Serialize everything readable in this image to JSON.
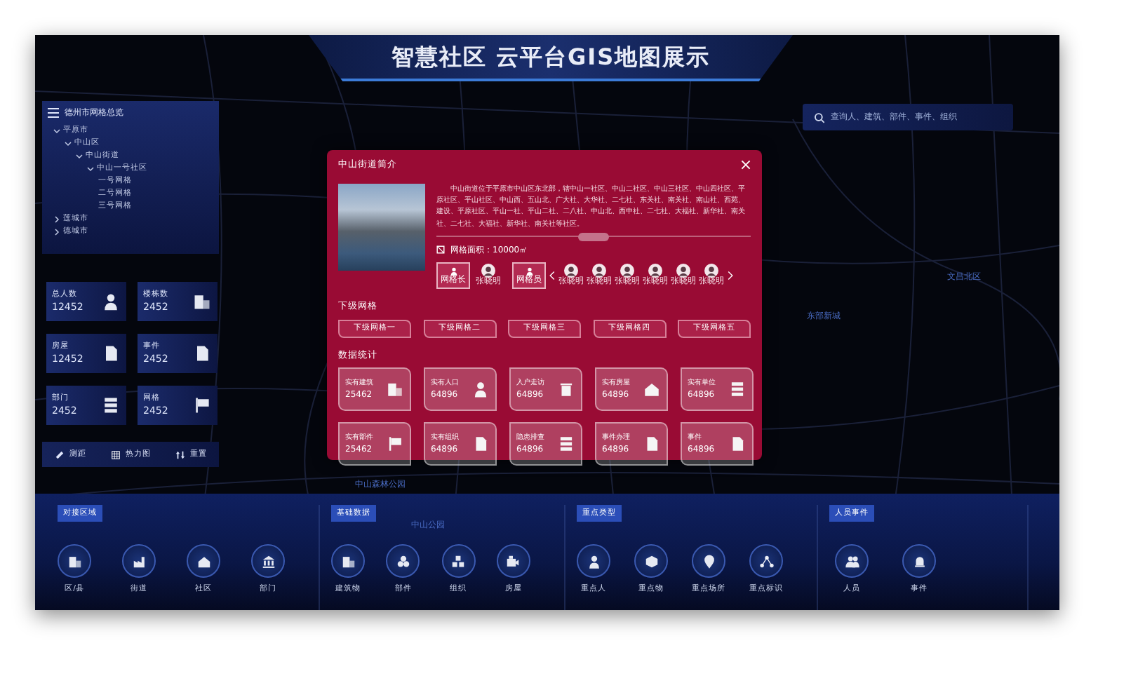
{
  "header": {
    "title": "智慧社区 云平台GIS地图展示"
  },
  "search": {
    "placeholder": "查询人、建筑、部件、事件、组织"
  },
  "grid_panel": {
    "title": "德州市网格总览",
    "tree": [
      {
        "label": "平原市",
        "expanded": true,
        "children": [
          {
            "label": "中山区",
            "expanded": true,
            "children": [
              {
                "label": "中山街道",
                "expanded": true,
                "children": [
                  {
                    "label": "中山一号社区",
                    "expanded": true,
                    "children": [
                      {
                        "label": "一号网格"
                      },
                      {
                        "label": "二号网格"
                      },
                      {
                        "label": "三号网格"
                      }
                    ]
                  }
                ]
              }
            ]
          }
        ]
      },
      {
        "label": "莲城市",
        "expanded": false
      },
      {
        "label": "德城市",
        "expanded": false
      }
    ]
  },
  "stats": [
    {
      "label": "总人数",
      "value": "12452"
    },
    {
      "label": "楼栋数",
      "value": "2452"
    },
    {
      "label": "房屋",
      "value": "12452"
    },
    {
      "label": "事件",
      "value": "2452"
    },
    {
      "label": "部门",
      "value": "2452"
    },
    {
      "label": "网格",
      "value": "2452"
    }
  ],
  "tools": [
    {
      "label": "测距"
    },
    {
      "label": "热力图"
    },
    {
      "label": "重置"
    }
  ],
  "map_labels": [
    {
      "text": "中山森林公园"
    },
    {
      "text": "东部新城"
    },
    {
      "text": "文昌北区"
    },
    {
      "text": "中山公园"
    }
  ],
  "modal": {
    "title": "中山街道简介",
    "intro": "中山街道位于平原市中山区东北部，辖中山一社区、中山二社区、中山三社区、中山四社区、平原社区、平山社区、中山西、五山北、广大社、大华社、二七社、东关社、南关社、南山社、西苑、建设、平原社区、平山一社、平山二社、二八社、中山北、西中社、二七社、大福社、新华社、南关社、二七社、大福社、新华社、南关社等社区。",
    "area": "网格面积：10000㎡",
    "leader": {
      "role": "网格长",
      "name": "张晓明"
    },
    "members": {
      "role": "网格员",
      "names": [
        "张晓明",
        "张晓明",
        "张晓明",
        "张晓明",
        "张晓明",
        "张晓明"
      ]
    },
    "sub_section": "下级网格",
    "sub_grids": [
      "下级网格一",
      "下级网格二",
      "下级网格三",
      "下级网格四",
      "下级网格五"
    ],
    "stats_section": "数据统计",
    "stats": [
      {
        "label": "实有建筑",
        "value": "25462"
      },
      {
        "label": "实有人口",
        "value": "64896"
      },
      {
        "label": "入户走访",
        "value": "64896"
      },
      {
        "label": "实有房屋",
        "value": "64896"
      },
      {
        "label": "实有单位",
        "value": "64896"
      },
      {
        "label": "实有部件",
        "value": "25462"
      },
      {
        "label": "实有组织",
        "value": "64896"
      },
      {
        "label": "隐患排查",
        "value": "64896"
      },
      {
        "label": "事件办理",
        "value": "64896"
      },
      {
        "label": "事件",
        "value": "64896"
      }
    ]
  },
  "bottom_groups": [
    {
      "title": "对接区域",
      "items": [
        "区/县",
        "街道",
        "社区",
        "部门"
      ]
    },
    {
      "title": "基础数据",
      "items": [
        "建筑物",
        "部件",
        "组织",
        "房屋"
      ]
    },
    {
      "title": "重点类型",
      "items": [
        "重点人",
        "重点物",
        "重点场所",
        "重点标识"
      ]
    },
    {
      "title": "人员事件",
      "items": [
        "人员",
        "事件"
      ]
    }
  ]
}
